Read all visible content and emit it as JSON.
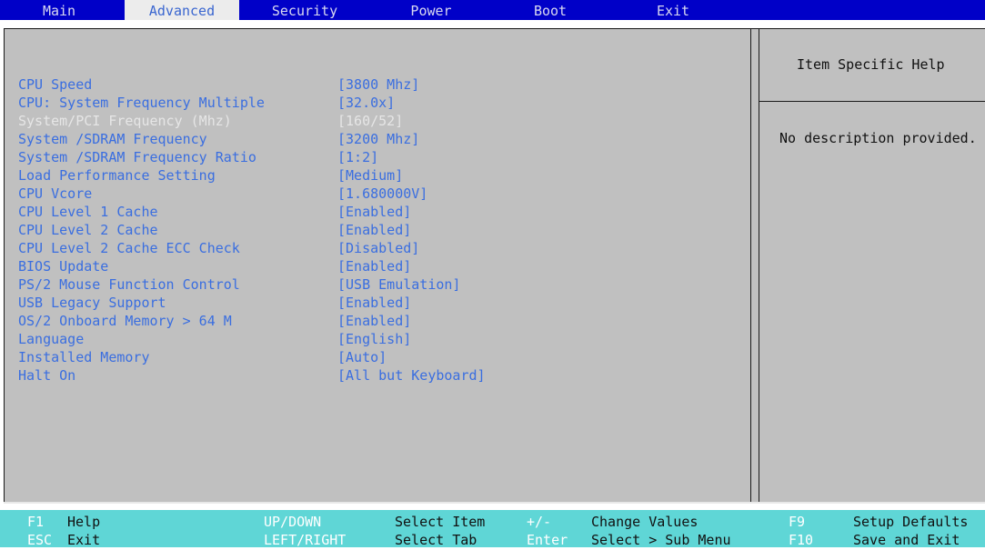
{
  "tabs": [
    {
      "label": "Main",
      "active": false
    },
    {
      "label": "Advanced",
      "active": true
    },
    {
      "label": "Security",
      "active": false
    },
    {
      "label": "Power",
      "active": false
    },
    {
      "label": "Boot",
      "active": false
    },
    {
      "label": "Exit",
      "active": false
    }
  ],
  "settings": [
    {
      "label": "CPU Speed",
      "value": "[3800 Mhz]",
      "disabled": false
    },
    {
      "label": "CPU: System Frequency Multiple",
      "value": "[32.0x]",
      "disabled": false
    },
    {
      "label": "System/PCI Frequency (Mhz)",
      "value": "[160/52]",
      "disabled": true
    },
    {
      "label": "System /SDRAM Frequency",
      "value": "[3200 Mhz]",
      "disabled": false
    },
    {
      "label": "System /SDRAM Frequency Ratio",
      "value": "[1:2]",
      "disabled": false
    },
    {
      "label": "Load Performance Setting",
      "value": "[Medium]",
      "disabled": false
    },
    {
      "label": "CPU Vcore",
      "value": "[1.680000V]",
      "disabled": false
    },
    {
      "label": "CPU Level 1 Cache",
      "value": "[Enabled]",
      "disabled": false
    },
    {
      "label": "CPU Level 2 Cache",
      "value": "[Enabled]",
      "disabled": false
    },
    {
      "label": "CPU Level 2 Cache ECC Check",
      "value": "[Disabled]",
      "disabled": false
    },
    {
      "label": "BIOS Update",
      "value": "[Enabled]",
      "disabled": false
    },
    {
      "label": "PS/2 Mouse Function Control",
      "value": "[USB Emulation]",
      "disabled": false
    },
    {
      "label": "USB Legacy Support",
      "value": "[Enabled]",
      "disabled": false
    },
    {
      "label": "OS/2 Onboard Memory > 64 M",
      "value": "[Enabled]",
      "disabled": false
    },
    {
      "label": "Language",
      "value": "[English]",
      "disabled": false
    },
    {
      "label": "Installed Memory",
      "value": "[Auto]",
      "disabled": false
    },
    {
      "label": "Halt On",
      "value": "[All but Keyboard]",
      "disabled": false
    }
  ],
  "help_panel": {
    "title": "Item Specific Help",
    "text": "No description provided."
  },
  "footer": [
    {
      "key": "F1",
      "desc": "Help"
    },
    {
      "key": "ESC",
      "desc": "Exit"
    },
    {
      "key": "UP/DOWN",
      "desc": "Select Item"
    },
    {
      "key": "LEFT/RIGHT",
      "desc": "Select Tab"
    },
    {
      "key": "+/-",
      "desc": "Change Values"
    },
    {
      "key": "Enter",
      "desc": "Select > Sub Menu"
    },
    {
      "key": "F9",
      "desc": "Setup Defaults"
    },
    {
      "key": "F10",
      "desc": "Save and Exit"
    }
  ],
  "colors": {
    "tab_bar": "#0000c8",
    "tab_text": "#d8d8f0",
    "active_tab_bg": "#ececec",
    "setting_text": "#3a6ee0",
    "disabled_text": "#e6e6e6",
    "panel_bg": "#c0c0c0",
    "status_bar": "#5fd6d6",
    "status_key": "#ffffff",
    "status_desc": "#111111"
  }
}
